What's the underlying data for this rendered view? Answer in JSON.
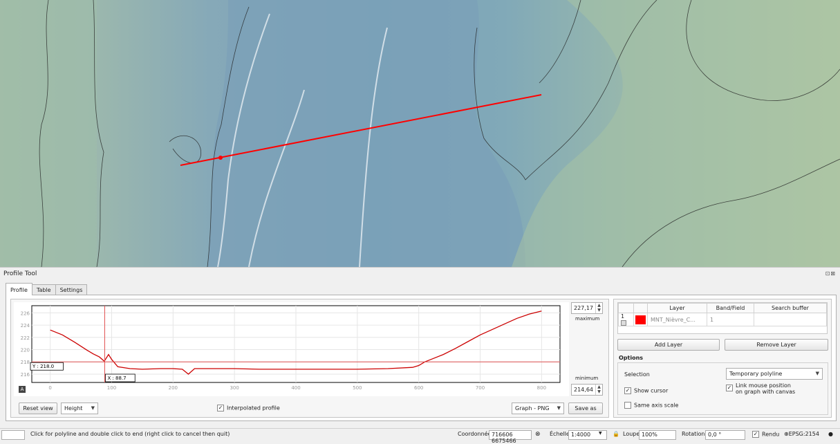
{
  "panel": {
    "title": "Profile Tool",
    "window_controls": "⊡⊠",
    "tabs": [
      {
        "label": "Profile",
        "active": true
      },
      {
        "label": "Table",
        "active": false
      },
      {
        "label": "Settings",
        "active": false
      }
    ]
  },
  "chart_data": {
    "type": "line",
    "series": [
      {
        "color": "#cc0000",
        "x": [
          0,
          20,
          40,
          60,
          70,
          80,
          88,
          95,
          100,
          110,
          130,
          150,
          180,
          200,
          215,
          225,
          235,
          260,
          300,
          340,
          400,
          450,
          500,
          550,
          590,
          600,
          610,
          620,
          640,
          660,
          680,
          700,
          720,
          740,
          760,
          780,
          800
        ],
        "y": [
          223.2,
          222.4,
          221.2,
          219.9,
          219.3,
          218.8,
          218.1,
          219.2,
          218.4,
          217.2,
          216.9,
          216.8,
          216.9,
          216.9,
          216.8,
          216.0,
          216.9,
          216.9,
          216.9,
          216.8,
          216.8,
          216.8,
          216.8,
          216.9,
          217.1,
          217.4,
          218.0,
          218.4,
          219.2,
          220.2,
          221.3,
          222.4,
          223.3,
          224.2,
          225.1,
          225.8,
          226.3
        ]
      }
    ],
    "xlim": [
      -30,
      830
    ],
    "ylim": [
      214.64,
      227.17
    ],
    "xticks": [
      0,
      100,
      200,
      300,
      400,
      500,
      600,
      700,
      800
    ],
    "yticks": [
      216,
      218,
      220,
      222,
      224,
      226
    ],
    "grid": true,
    "cursor": {
      "x": 88.7,
      "y": 218.0,
      "x_label": "X : 88.7",
      "y_label": "Y : 218.0"
    }
  },
  "axis_controls": {
    "max_value": "227,17",
    "max_label": "maximum",
    "min_value": "214,64",
    "min_label": "minimum",
    "a_badge": "A"
  },
  "bottom_controls": {
    "reset_view": "Reset view",
    "height_combo": "Height",
    "interpolated_label": "Interpolated profile",
    "interpolated_checked": true,
    "graph_combo": "Graph - PNG",
    "save_as": "Save as"
  },
  "layers_table": {
    "headers": [
      "Layer",
      "Band/Field",
      "Search buffer"
    ],
    "rows": [
      {
        "index": "1",
        "color": "#ff0000",
        "layer": "MNT_Nièvre_C...",
        "band": "1",
        "buffer": ""
      }
    ]
  },
  "layer_buttons": {
    "add": "Add Layer",
    "remove": "Remove Layer"
  },
  "options": {
    "title": "Options",
    "selection_label": "Selection",
    "selection_value": "Temporary polyline",
    "show_cursor": "Show cursor",
    "show_cursor_checked": true,
    "link_mouse_l1": "Link mouse position",
    "link_mouse_l2": "on graph with canvas",
    "link_mouse_checked": true,
    "same_axis": "Same axis scale",
    "same_axis_checked": false
  },
  "statusbar": {
    "message": "Click for polyline and double click to end (right click to cancel then quit)",
    "coord_label": "Coordonnée",
    "coord_value": "716606 6675466",
    "scale_label": "Échelle",
    "scale_value": "1:4000",
    "magnifier_label": "Loupe",
    "magnifier_value": "100%",
    "rotation_label": "Rotation",
    "rotation_value": "0,0 °",
    "render_label": "Rendu",
    "epsg": "EPSG:2154"
  },
  "colors": {
    "map_blue": "#7fa6bb",
    "map_green": "#a9c0a4",
    "profile_line": "#ff0000"
  }
}
